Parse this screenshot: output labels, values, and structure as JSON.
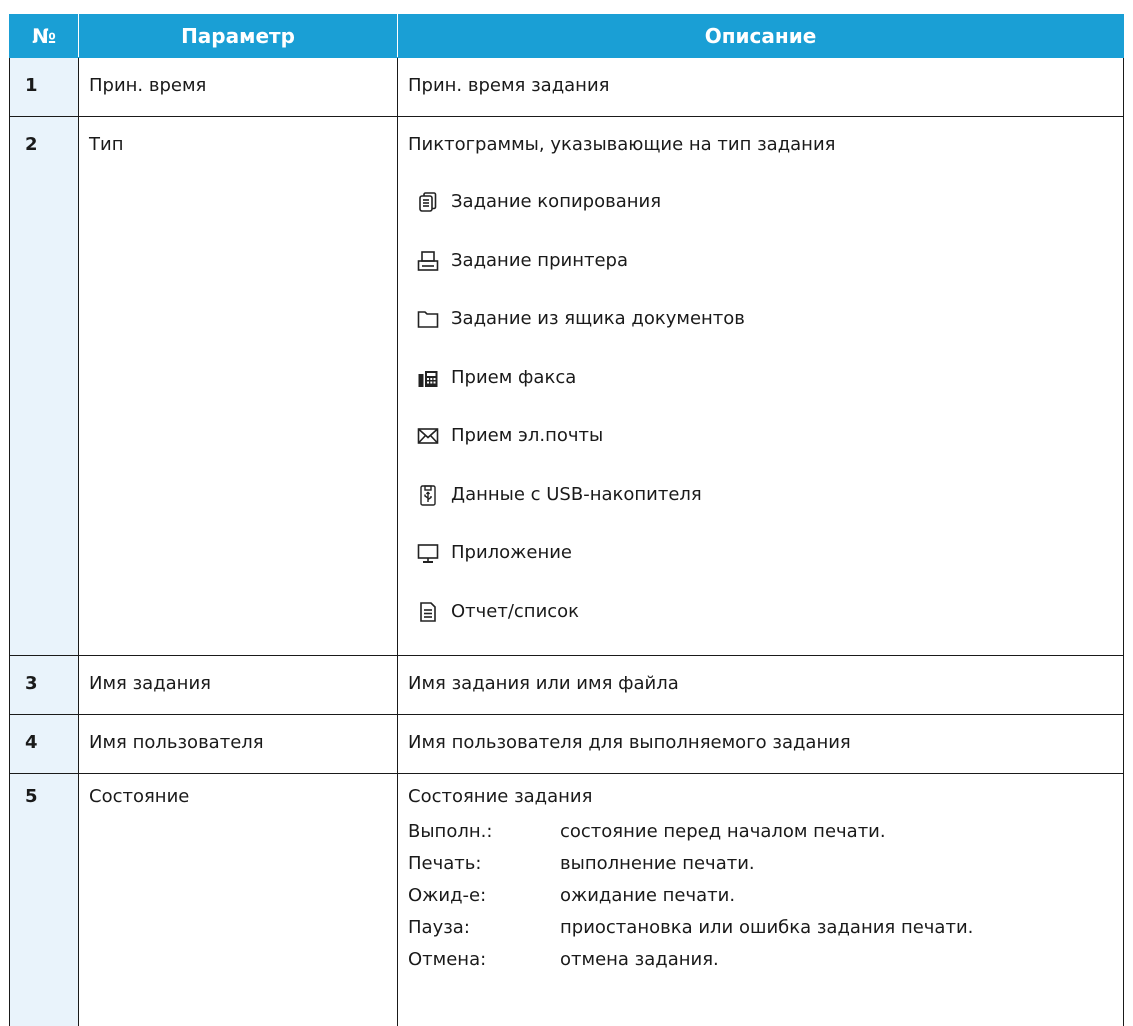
{
  "table": {
    "headers": {
      "num": "№",
      "param": "Параметр",
      "desc": "Описание"
    },
    "rows": [
      {
        "num": "1",
        "param": "Прин. время",
        "desc": "Прин. время задания"
      },
      {
        "num": "2",
        "param": "Тип",
        "desc": "Пиктограммы, указывающие на тип задания",
        "types": [
          {
            "icon": "copy-job-icon",
            "label": "Задание копирования"
          },
          {
            "icon": "printer-icon",
            "label": "Задание принтера"
          },
          {
            "icon": "folder-icon",
            "label": "Задание из ящика документов"
          },
          {
            "icon": "fax-icon",
            "label": "Прием факса"
          },
          {
            "icon": "envelope-icon",
            "label": "Прием эл.почты"
          },
          {
            "icon": "usb-drive-icon",
            "label": "Данные с USB-накопителя"
          },
          {
            "icon": "monitor-icon",
            "label": "Приложение"
          },
          {
            "icon": "report-list-icon",
            "label": "Отчет/список"
          }
        ]
      },
      {
        "num": "3",
        "param": "Имя задания",
        "desc": "Имя задания или имя файла"
      },
      {
        "num": "4",
        "param": "Имя пользователя",
        "desc": "Имя пользователя для выполняемого задания"
      },
      {
        "num": "5",
        "param": "Состояние",
        "desc": "Состояние задания",
        "states": [
          {
            "key": "Выполн.:",
            "value": "состояние перед началом печати."
          },
          {
            "key": "Печать:",
            "value": "выполнение печати."
          },
          {
            "key": "Ожид-е:",
            "value": "ожидание печати."
          },
          {
            "key": "Пауза:",
            "value": "приостановка или ошибка задания печати."
          },
          {
            "key": "Отмена:",
            "value": "отмена задания."
          }
        ]
      }
    ]
  }
}
